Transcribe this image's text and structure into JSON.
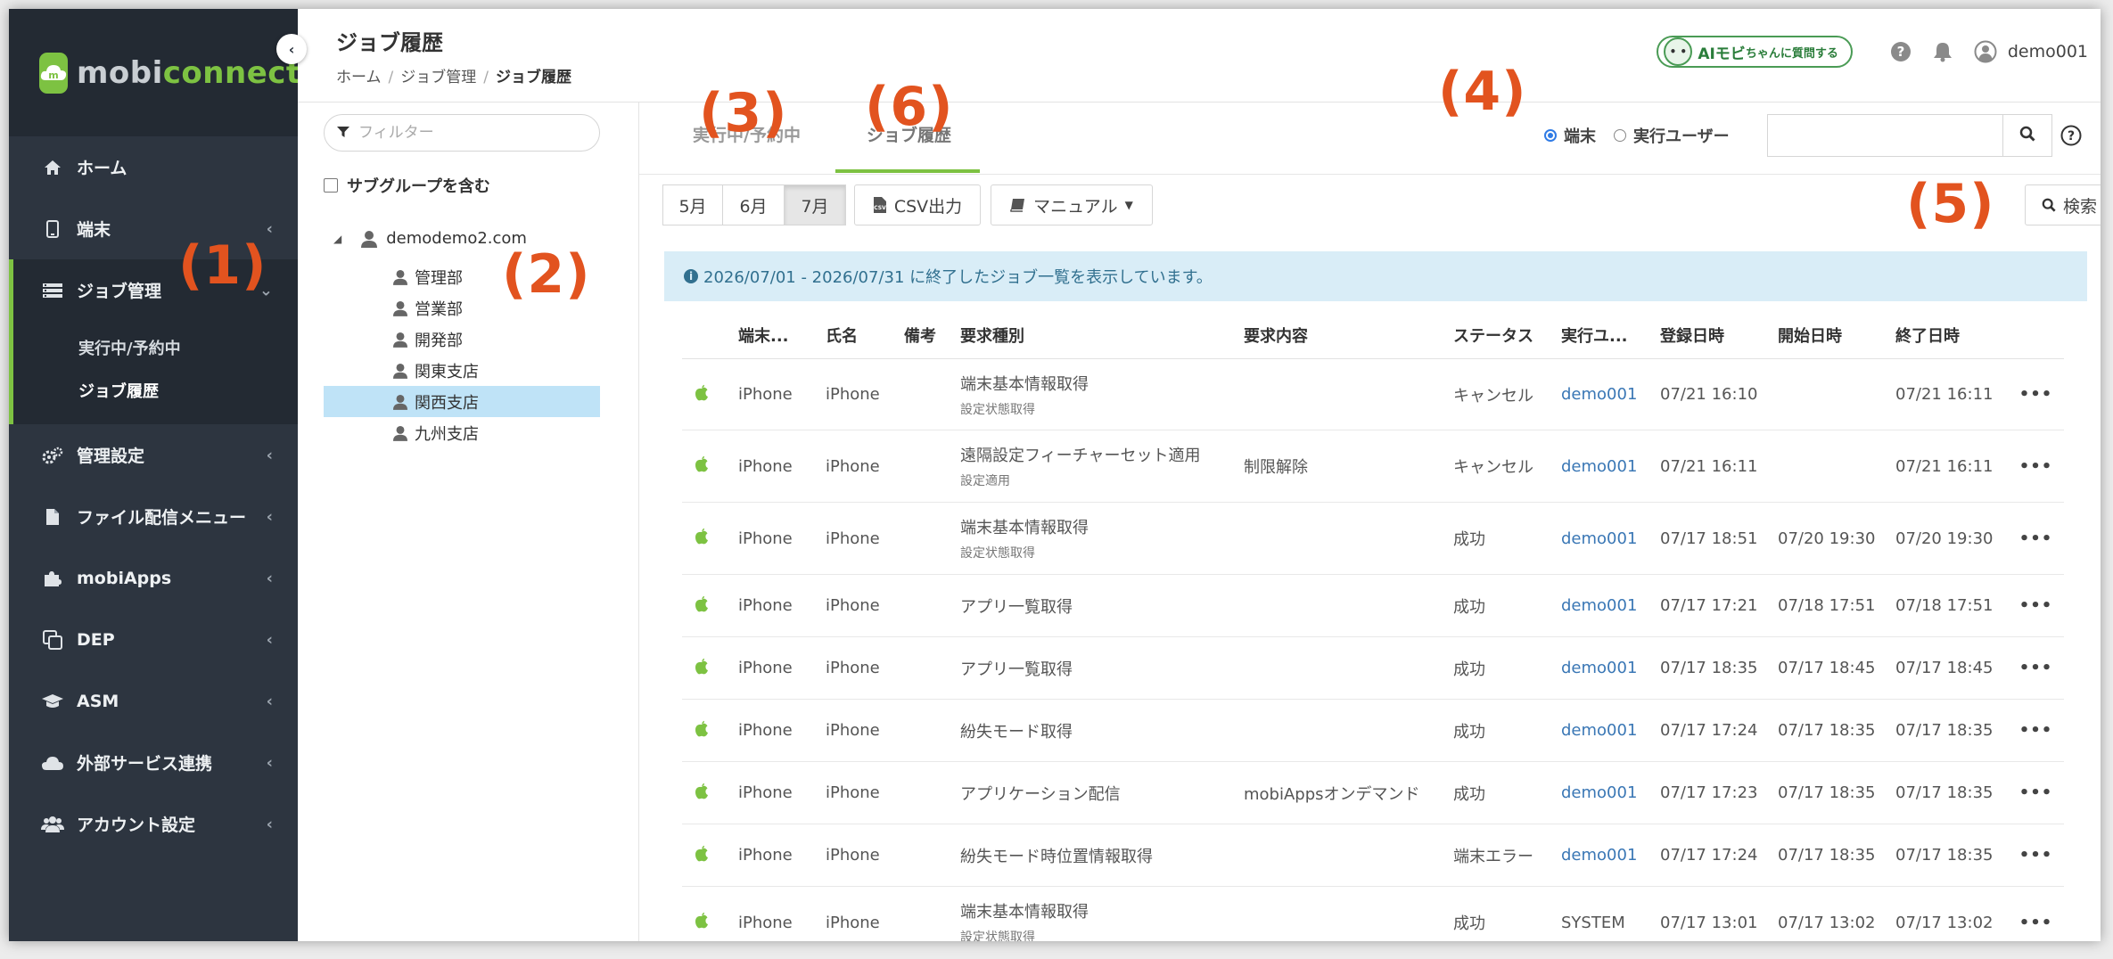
{
  "brand": {
    "mobi": "mobi",
    "connect": "connect"
  },
  "sidebar": {
    "items": [
      {
        "label": "ホーム",
        "icon": "home-icon",
        "chevron": ""
      },
      {
        "label": "端末",
        "icon": "device-icon",
        "chevron": "‹"
      },
      {
        "label": "ジョブ管理",
        "icon": "list-icon",
        "chevron": "⌄"
      },
      {
        "label": "管理設定",
        "icon": "gears-icon",
        "chevron": "‹"
      },
      {
        "label": "ファイル配信メニュー",
        "icon": "file-icon",
        "chevron": "‹"
      },
      {
        "label": "mobiApps",
        "icon": "puzzle-icon",
        "chevron": "‹"
      },
      {
        "label": "DEP",
        "icon": "copy-icon",
        "chevron": "‹"
      },
      {
        "label": "ASM",
        "icon": "graduation-cap-icon",
        "chevron": "‹"
      },
      {
        "label": "外部サービス連携",
        "icon": "cloud-icon",
        "chevron": "‹"
      },
      {
        "label": "アカウント設定",
        "icon": "users-icon",
        "chevron": "‹"
      }
    ],
    "subitems": [
      {
        "label": "実行中/予約中"
      },
      {
        "label": "ジョブ履歴"
      }
    ]
  },
  "header": {
    "title": "ジョブ履歴",
    "breadcrumb": [
      "ホーム",
      "ジョブ管理",
      "ジョブ履歴"
    ],
    "ai_button": {
      "prefix": "AIモビ",
      "mid": "ちゃん",
      "suffix": "に質問する"
    },
    "user": "demo001"
  },
  "tree": {
    "filter_placeholder": "フィルター",
    "include_subgroups": "サブグループを含む",
    "root": "demodemo2.com",
    "nodes": [
      "管理部",
      "営業部",
      "開発部",
      "関東支店",
      "関西支店",
      "九州支店"
    ],
    "selected_index": 4
  },
  "tabs": [
    {
      "label": "実行中/予約中"
    },
    {
      "label": "ジョブ履歴"
    }
  ],
  "search": {
    "radio_device": "端末",
    "radio_user": "実行ユーザー",
    "selected": "端末",
    "value": ""
  },
  "toolbar": {
    "months": [
      "5月",
      "6月",
      "7月"
    ],
    "active_month": "7月",
    "csv": "CSV出力",
    "manual": "マニュアル",
    "search_btn": "検索"
  },
  "info": "2026/07/01 - 2026/07/31 に終了したジョブ一覧を表示しています。",
  "table": {
    "headers": [
      "",
      "端末...",
      "氏名",
      "備考",
      "要求種別",
      "要求内容",
      "ステータス",
      "実行ユ...",
      "登録日時",
      "開始日時",
      "終了日時",
      ""
    ],
    "rows": [
      {
        "device": "iPhone",
        "name": "iPhone",
        "note": "",
        "type": "端末基本情報取得",
        "type_sub": "設定状態取得",
        "req": "",
        "status": "キャンセル",
        "user": "demo001",
        "user_link": true,
        "reg": "07/21 16:10",
        "start": "",
        "end": "07/21 16:11"
      },
      {
        "device": "iPhone",
        "name": "iPhone",
        "note": "",
        "type": "遠隔設定フィーチャーセット適用",
        "type_sub": "設定適用",
        "req": "制限解除",
        "status": "キャンセル",
        "user": "demo001",
        "user_link": true,
        "reg": "07/21 16:11",
        "start": "",
        "end": "07/21 16:11"
      },
      {
        "device": "iPhone",
        "name": "iPhone",
        "note": "",
        "type": "端末基本情報取得",
        "type_sub": "設定状態取得",
        "req": "",
        "status": "成功",
        "user": "demo001",
        "user_link": true,
        "reg": "07/17 18:51",
        "start": "07/20 19:30",
        "end": "07/20 19:30"
      },
      {
        "device": "iPhone",
        "name": "iPhone",
        "note": "",
        "type": "アプリ一覧取得",
        "type_sub": "",
        "req": "",
        "status": "成功",
        "user": "demo001",
        "user_link": true,
        "reg": "07/17 17:21",
        "start": "07/18 17:51",
        "end": "07/18 17:51"
      },
      {
        "device": "iPhone",
        "name": "iPhone",
        "note": "",
        "type": "アプリ一覧取得",
        "type_sub": "",
        "req": "",
        "status": "成功",
        "user": "demo001",
        "user_link": true,
        "reg": "07/17 18:35",
        "start": "07/17 18:45",
        "end": "07/17 18:45"
      },
      {
        "device": "iPhone",
        "name": "iPhone",
        "note": "",
        "type": "紛失モード取得",
        "type_sub": "",
        "req": "",
        "status": "成功",
        "user": "demo001",
        "user_link": true,
        "reg": "07/17 17:24",
        "start": "07/17 18:35",
        "end": "07/17 18:35"
      },
      {
        "device": "iPhone",
        "name": "iPhone",
        "note": "",
        "type": "アプリケーション配信",
        "type_sub": "",
        "req": "mobiAppsオンデマンド",
        "status": "成功",
        "user": "demo001",
        "user_link": true,
        "reg": "07/17 17:23",
        "start": "07/17 18:35",
        "end": "07/17 18:35"
      },
      {
        "device": "iPhone",
        "name": "iPhone",
        "note": "",
        "type": "紛失モード時位置情報取得",
        "type_sub": "",
        "req": "",
        "status": "端末エラー",
        "user": "demo001",
        "user_link": true,
        "reg": "07/17 17:24",
        "start": "07/17 18:35",
        "end": "07/17 18:35"
      },
      {
        "device": "iPhone",
        "name": "iPhone",
        "note": "",
        "type": "端末基本情報取得",
        "type_sub": "設定状態取得",
        "req": "",
        "status": "成功",
        "user": "SYSTEM",
        "user_link": false,
        "reg": "07/17 13:01",
        "start": "07/17 13:02",
        "end": "07/17 13:02"
      }
    ]
  },
  "annotations": [
    "(1)",
    "(2)",
    "(3)",
    "(4)",
    "(5)",
    "(6)"
  ],
  "colors": {
    "accent": "#7dc242",
    "sidebar": "#2d3540",
    "link": "#3a77b5",
    "annotation": "#e2531f",
    "info_bg": "#d9edf7"
  }
}
